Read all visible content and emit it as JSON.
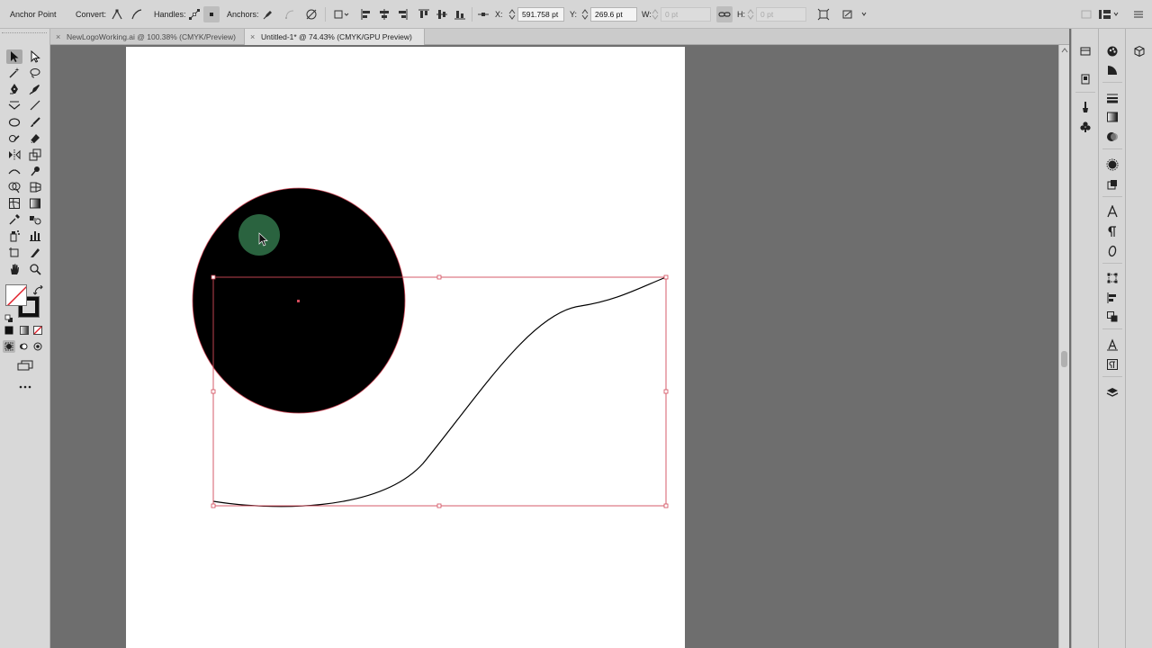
{
  "control_bar": {
    "tool_name": "Anchor Point",
    "convert_label": "Convert:",
    "handles_label": "Handles:",
    "anchors_label": "Anchors:",
    "x_label": "X:",
    "x_value": "591.758 pt",
    "y_label": "Y:",
    "y_value": "269.6 pt",
    "w_label": "W:",
    "w_value": "0 pt",
    "h_label": "H:",
    "h_value": "0 pt"
  },
  "tabs": [
    {
      "label": "NewLogoWorking.ai @ 100.38% (CMYK/Preview)",
      "active": false
    },
    {
      "label": "Untitled-1* @ 74.43% (CMYK/GPU Preview)",
      "active": true
    }
  ],
  "tab_close_glyph": "×",
  "colors": {
    "selection": "#d24a5a",
    "circle_fill": "#000000",
    "cursor_highlight": "#2e6b44",
    "ui_panel": "#d6d6d6",
    "pasteboard": "#6e6e6e"
  },
  "icons": {
    "more_tools": "more-tools-icon"
  }
}
